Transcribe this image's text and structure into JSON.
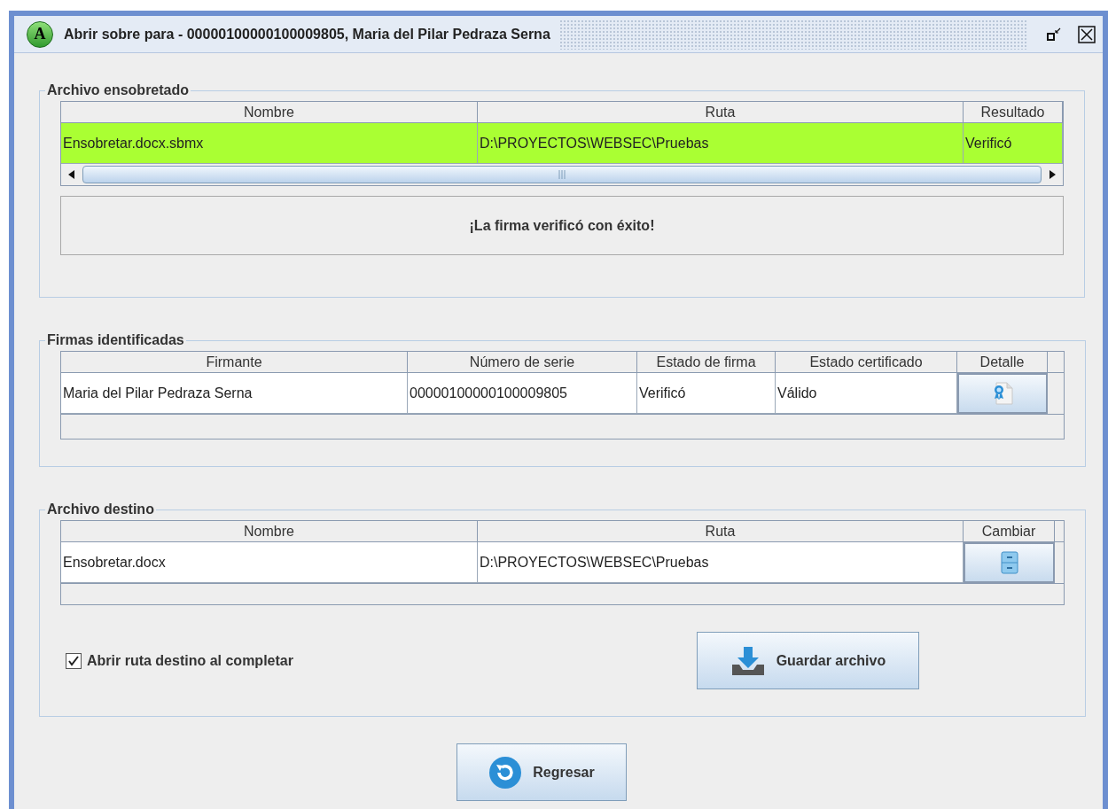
{
  "window": {
    "logo": "A",
    "title": "Abrir sobre para - 00000100000100009805, Maria del Pilar Pedraza Serna"
  },
  "archivo_ensobretado": {
    "title": "Archivo ensobretado",
    "columns": [
      "Nombre",
      "Ruta",
      "Resultado"
    ],
    "rows": [
      {
        "cells": [
          "Ensobretar.docx.sbmx",
          "D:\\PROYECTOS\\WEBSEC\\Pruebas",
          "Verificó"
        ],
        "selected": true
      }
    ],
    "message": "¡La firma verificó con éxito!"
  },
  "firmas_identificadas": {
    "title": "Firmas identificadas",
    "columns": [
      "Firmante",
      "Número de serie",
      "Estado de firma",
      "Estado certificado",
      "Detalle"
    ],
    "rows": [
      {
        "cells": [
          "Maria del Pilar Pedraza Serna",
          "00000100000100009805",
          "Verificó",
          "Válido"
        ],
        "selected": false,
        "action": {
          "kind": "certificate"
        }
      }
    ]
  },
  "archivo_destino": {
    "title": "Archivo destino",
    "columns": [
      "Nombre",
      "Ruta",
      "Cambiar"
    ],
    "rows": [
      {
        "cells": [
          "Ensobretar.docx",
          "D:\\PROYECTOS\\WEBSEC\\Pruebas"
        ],
        "selected": false,
        "action": {
          "kind": "cabinet"
        }
      }
    ],
    "open_on_complete": {
      "label": "Abrir ruta destino al completar",
      "checked": true
    },
    "save_button": "Guardar archivo"
  },
  "back_button": "Regresar"
}
